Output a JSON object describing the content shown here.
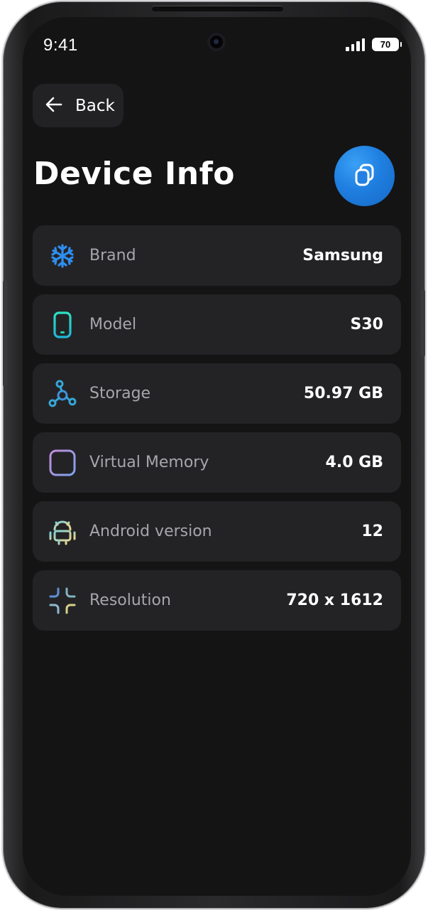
{
  "status_bar": {
    "time": "9:41",
    "battery_level": "70"
  },
  "header": {
    "back_label": "Back",
    "title": "Device Info"
  },
  "accent_color": "#1f7fe0",
  "info_rows": [
    {
      "label": "Brand",
      "value": "Samsung",
      "icon": "snowflake-icon",
      "icon_color": "#2f8ef0"
    },
    {
      "label": "Model",
      "value": "S30",
      "icon": "smartphone-icon",
      "icon_color": "#23d3b0"
    },
    {
      "label": "Storage",
      "value": "50.97 GB",
      "icon": "node-graph-icon",
      "icon_color": "#35a6d6"
    },
    {
      "label": "Virtual Memory",
      "value": "4.0 GB",
      "icon": "server-stack-icon",
      "icon_color": "#a98de8"
    },
    {
      "label": "Android version",
      "value": "12",
      "icon": "android-icon",
      "icon_color": "#c9d6a8"
    },
    {
      "label": "Resolution",
      "value": "720 x 1612",
      "icon": "shrink-arrows-icon",
      "icon_color": "#6fa8c8"
    }
  ]
}
